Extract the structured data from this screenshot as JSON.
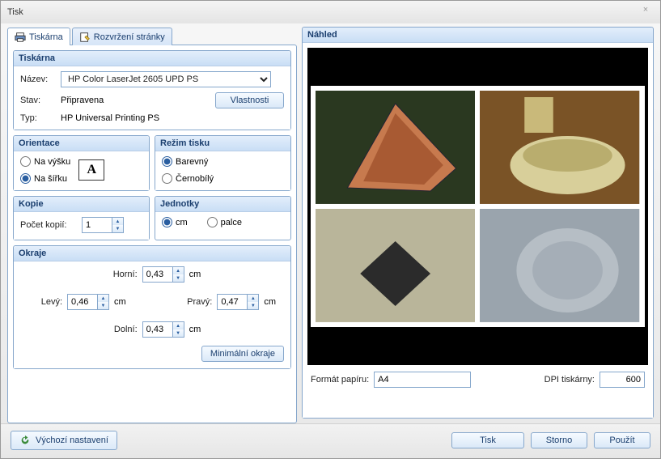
{
  "window": {
    "title": "Tisk"
  },
  "tabs": {
    "printer": "Tiskárna",
    "layout": "Rozvržení stránky"
  },
  "printer_group": {
    "title": "Tiskárna",
    "name_label": "Název:",
    "name_value": "HP Color LaserJet 2605 UPD PS",
    "status_label": "Stav:",
    "status_value": "Připravena",
    "type_label": "Typ:",
    "type_value": "HP Universal Printing PS",
    "properties_btn": "Vlastnosti"
  },
  "orientation": {
    "title": "Orientace",
    "portrait": "Na výšku",
    "landscape": "Na šířku",
    "selected": "landscape"
  },
  "print_mode": {
    "title": "Režim tisku",
    "color": "Barevný",
    "bw": "Černobílý",
    "selected": "color"
  },
  "copies": {
    "title": "Kopie",
    "label": "Počet kopií:",
    "value": "1"
  },
  "units": {
    "title": "Jednotky",
    "cm": "cm",
    "inch": "palce",
    "selected": "cm"
  },
  "margins": {
    "title": "Okraje",
    "top_label": "Horní:",
    "top_value": "0,43",
    "left_label": "Levý:",
    "left_value": "0,46",
    "right_label": "Pravý:",
    "right_value": "0,47",
    "bottom_label": "Dolní:",
    "bottom_value": "0,43",
    "unit": "cm",
    "min_btn": "Minimální okraje"
  },
  "preview": {
    "title": "Náhled",
    "paper_format_label": "Formát papíru:",
    "paper_format_value": "A4",
    "dpi_label": "DPI tiskárny:",
    "dpi_value": "600"
  },
  "footer": {
    "defaults": "Výchozí nastavení",
    "print": "Tisk",
    "cancel": "Storno",
    "apply": "Použít"
  }
}
